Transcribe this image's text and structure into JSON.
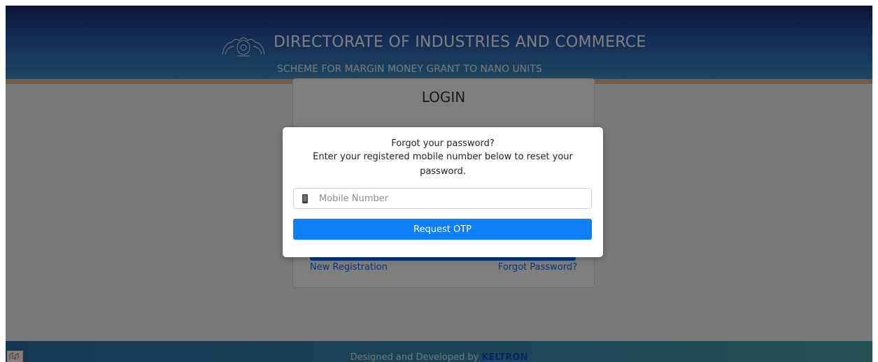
{
  "header": {
    "title": "DIRECTORATE OF INDUSTRIES AND COMMERCE",
    "subtitle": "SCHEME FOR MARGIN MONEY GRANT TO NANO UNITS",
    "emblem_icon": "kerala-emblem-icon"
  },
  "login": {
    "title": "LOGIN",
    "new_registration": "New Registration",
    "forgot_password": "Forgot Password?"
  },
  "modal": {
    "heading": "Forgot your password?",
    "instruction_line1": "Enter your registered mobile number below to reset your",
    "instruction_line2": "password.",
    "mobile_placeholder": "Mobile Number",
    "mobile_value": "",
    "phone_icon": "mobile-phone-icon",
    "request_otp_label": "Request OTP"
  },
  "footer": {
    "text": "Designed and Developed by",
    "brand": "KELTRON"
  },
  "colors": {
    "primary_button": "#0d7ff7",
    "link": "#0d6efd",
    "header_dark": "#1c2a6e",
    "header_light": "#3b8fc4",
    "header_stripe": "#e7b98c"
  }
}
